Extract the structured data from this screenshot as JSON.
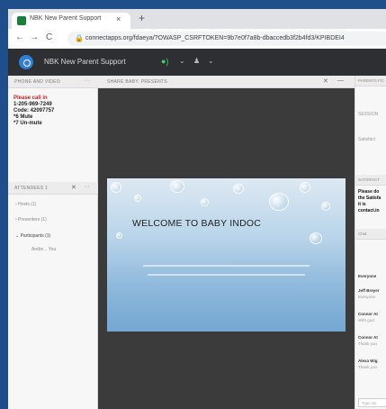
{
  "browser": {
    "tab_title": "NBK New Parent Support",
    "tab_close": "×",
    "new_tab": "+",
    "back": "←",
    "forward": "→",
    "reload": "C",
    "lock": "🔒",
    "url": "connectapps.org/fdaeya/?OWASP_CSRFTOKEN=9b7e0f7a8b-dbaccedb3f2b4fd3/KPIBDEI4"
  },
  "app": {
    "title": "NBK New Parent Support",
    "mic": "●)",
    "icons": [
      "⌄",
      "♟",
      "⌄"
    ]
  },
  "phone_pod": {
    "header": "PHONE AND VIDEO",
    "menu": "···",
    "lines": [
      "Please call in",
      "1-205-969-7249",
      "Code: 42097757",
      "*6 Mute",
      "*7 Un-mute"
    ]
  },
  "attendees_pod": {
    "header": "ATTENDEES  1",
    "close": "✕",
    "menu": "···",
    "items": [
      "›  Hosts (1)",
      "›  Presenters (1)",
      "⌄  Participants (1)",
      "Andre... You"
    ]
  },
  "share_pod": {
    "header": "SHARE BABY. PRESENTS",
    "icons": [
      "✕",
      "—"
    ]
  },
  "slide": {
    "title": "WELCOME TO BABY INDOC"
  },
  "right_pod": {
    "header1": "PARENTS FO",
    "session_label": "SESSION",
    "satisfaction": "Satisfact",
    "header2": "SATISFACT",
    "bold_lines": [
      "Please do",
      "the Satisfa",
      "it is",
      "contact.in"
    ],
    "chat_header": "Chat",
    "items": [
      {
        "title": "Everyone",
        "sub": ""
      },
      {
        "title": "Jeff Breyer",
        "sub": "Everyone"
      },
      {
        "title": "Connor At",
        "sub": "With god"
      },
      {
        "title": "Connor At",
        "sub": "Thank you"
      },
      {
        "title": "Alexa Wig",
        "sub": "Thank you"
      }
    ],
    "input_placeholder": "Type Se"
  }
}
